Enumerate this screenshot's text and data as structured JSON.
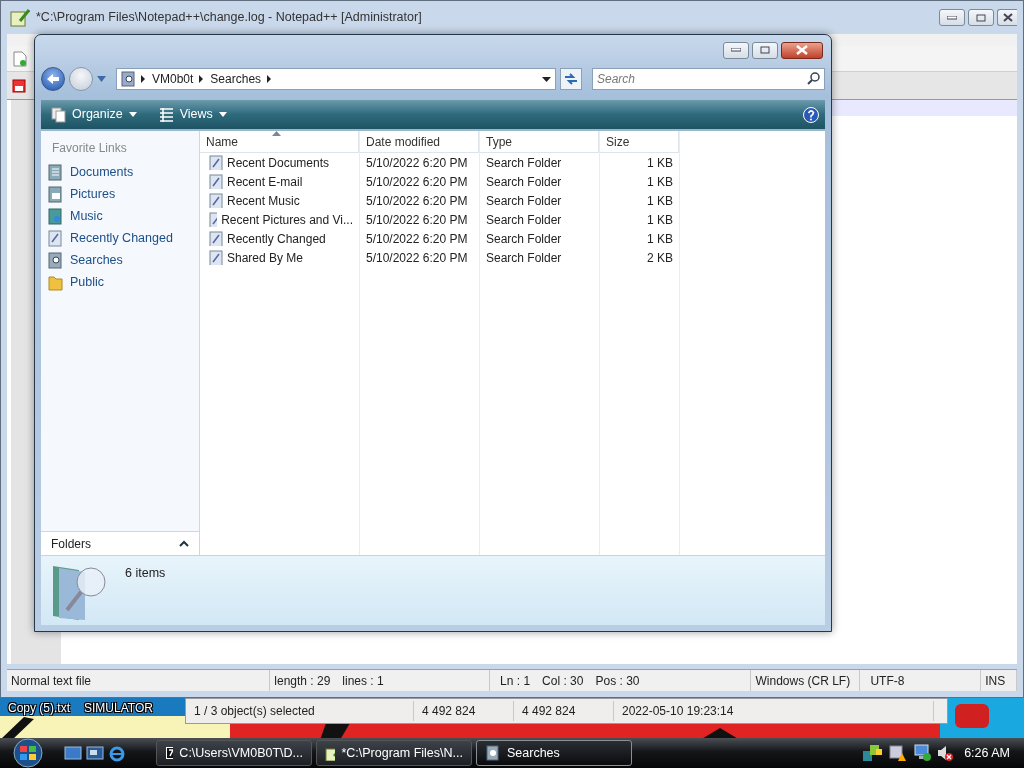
{
  "notepad": {
    "title": "*C:\\Program Files\\Notepad++\\change.log - Notepad++ [Administrator]",
    "status_bar": [
      {
        "texts": [
          "Normal text file"
        ]
      },
      {
        "texts": [
          "length : 29",
          "lines : 1"
        ]
      },
      {
        "texts": [
          "Ln : 1",
          "Col : 30",
          "Pos : 30"
        ]
      },
      {
        "texts": [
          "Windows (CR LF)"
        ]
      },
      {
        "texts": [
          "UTF-8"
        ]
      },
      {
        "texts": [
          "INS"
        ]
      }
    ]
  },
  "explorer": {
    "address": [
      "VM0b0t",
      "Searches"
    ],
    "search": {
      "placeholder": "Search"
    },
    "toolbar": [
      "Organize",
      "Views"
    ],
    "favorite_links": {
      "title": "Favorite Links",
      "items": [
        {
          "label": "Documents",
          "kind": "documents"
        },
        {
          "label": "Pictures",
          "kind": "pictures"
        },
        {
          "label": "Music",
          "kind": "music"
        },
        {
          "label": "Recently Changed",
          "kind": "search"
        },
        {
          "label": "Searches",
          "kind": "searches"
        },
        {
          "label": "Public",
          "kind": "folder"
        }
      ]
    },
    "folders": "Folders",
    "columns": [
      {
        "label": "Name",
        "sorted": true
      },
      {
        "label": "Date modified",
        "sorted": false
      },
      {
        "label": "Type",
        "sorted": false
      },
      {
        "label": "Size",
        "sorted": false
      }
    ],
    "rows": [
      {
        "name": "Recent Documents",
        "date": "5/10/2022 6:20 PM",
        "type": "Search Folder",
        "size": "1 KB"
      },
      {
        "name": "Recent E-mail",
        "date": "5/10/2022 6:20 PM",
        "type": "Search Folder",
        "size": "1 KB"
      },
      {
        "name": "Recent Music",
        "date": "5/10/2022 6:20 PM",
        "type": "Search Folder",
        "size": "1 KB"
      },
      {
        "name": "Recent Pictures and Vi...",
        "date": "5/10/2022 6:20 PM",
        "type": "Search Folder",
        "size": "1 KB"
      },
      {
        "name": "Recently Changed",
        "date": "5/10/2022 6:20 PM",
        "type": "Search Folder",
        "size": "1 KB"
      },
      {
        "name": "Shared By Me",
        "date": "5/10/2022 6:20 PM",
        "type": "Search Folder",
        "size": "2 KB"
      }
    ],
    "details": "6 items"
  },
  "archive_window": {
    "status_bar": [
      "1 / 3 object(s) selected",
      "4 492 824",
      "4 492 824",
      "2022-05-10 19:23:14"
    ]
  },
  "desktop": {
    "icons": [
      {
        "label": "Copy (5).txt"
      },
      {
        "label": "SIMULATOR"
      }
    ]
  },
  "taskbar": {
    "tasks": [
      {
        "label": "C:\\Users\\VM0B0T\\D...",
        "kind": "archive",
        "selected": false
      },
      {
        "label": "*C:\\Program Files\\N...",
        "kind": "notepad",
        "selected": false
      },
      {
        "label": "Searches",
        "kind": "explorer",
        "selected": true
      }
    ],
    "clock": "6:26 AM"
  }
}
